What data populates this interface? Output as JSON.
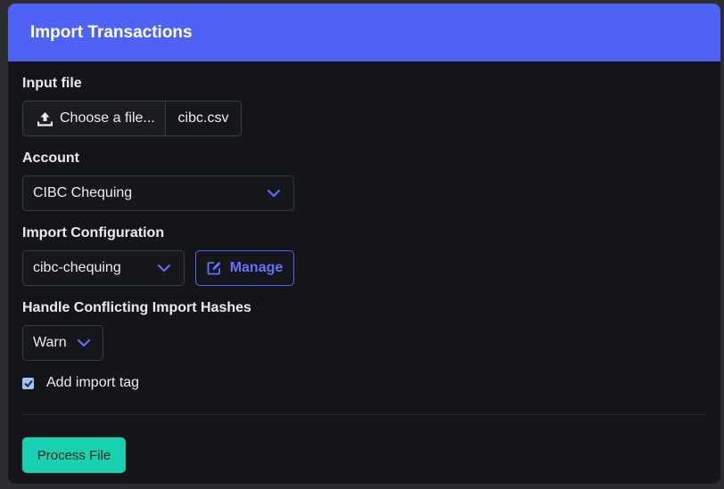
{
  "header": {
    "title": "Import Transactions"
  },
  "input_file": {
    "label": "Input file",
    "button_label": "Choose a file...",
    "file_name": "cibc.csv",
    "icon": "upload-icon"
  },
  "account": {
    "label": "Account",
    "selected": "CIBC Chequing"
  },
  "import_configuration": {
    "label": "Import Configuration",
    "selected": "cibc-chequing",
    "manage_label": "Manage",
    "manage_icon": "edit-icon"
  },
  "conflict_handling": {
    "label": "Handle Conflicting Import Hashes",
    "selected": "Warn"
  },
  "add_import_tag": {
    "label": "Add import tag",
    "checked": true
  },
  "actions": {
    "process_label": "Process File"
  },
  "colors": {
    "header_bg": "#4f62f6",
    "accent": "#5063f4",
    "process_button": "#17d1b0",
    "checkbox": "#9ec3f5"
  }
}
